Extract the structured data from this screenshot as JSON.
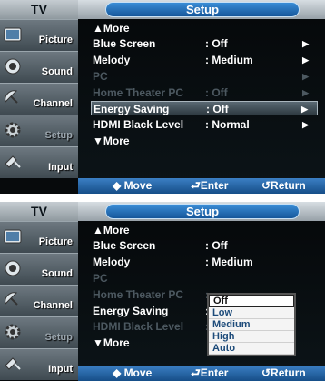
{
  "screen1": {
    "tv_label": "TV",
    "title": "Setup",
    "sidebar": [
      {
        "label": "Picture"
      },
      {
        "label": "Sound"
      },
      {
        "label": "Channel"
      },
      {
        "label": "Setup"
      },
      {
        "label": "Input"
      }
    ],
    "rows": [
      {
        "label": "▲More",
        "value": "",
        "arrow": ""
      },
      {
        "label": "Blue Screen",
        "value": ": Off",
        "arrow": "▶"
      },
      {
        "label": "Melody",
        "value": ": Medium",
        "arrow": "▶"
      },
      {
        "label": "PC",
        "value": "",
        "arrow": "▶"
      },
      {
        "label": "Home Theater PC",
        "value": ": Off",
        "arrow": "▶"
      },
      {
        "label": "Energy Saving",
        "value": ": Off",
        "arrow": "▶"
      },
      {
        "label": "HDMI Black Level",
        "value": ": Normal",
        "arrow": "▶"
      },
      {
        "label": "▼More",
        "value": "",
        "arrow": ""
      }
    ],
    "footer": {
      "move": "◆ Move",
      "enter": "⮐Enter",
      "return": "↺Return"
    }
  },
  "screen2": {
    "tv_label": "TV",
    "title": "Setup",
    "sidebar": [
      {
        "label": "Picture"
      },
      {
        "label": "Sound"
      },
      {
        "label": "Channel"
      },
      {
        "label": "Setup"
      },
      {
        "label": "Input"
      }
    ],
    "rows": [
      {
        "label": "▲More",
        "value": ""
      },
      {
        "label": "Blue Screen",
        "value": ": Off"
      },
      {
        "label": "Melody",
        "value": ": Medium"
      },
      {
        "label": "PC",
        "value": ""
      },
      {
        "label": "Home Theater PC",
        "value": ":"
      },
      {
        "label": "Energy Saving",
        "value": ":"
      },
      {
        "label": "HDMI Black Level",
        "value": ":"
      },
      {
        "label": "▼More",
        "value": ""
      }
    ],
    "dropdown": {
      "options": [
        "Off",
        "Low",
        "Medium",
        "High",
        "Auto"
      ],
      "selected": "Off"
    },
    "footer": {
      "move": "◆ Move",
      "enter": "⮐Enter",
      "return": "↺Return"
    }
  }
}
